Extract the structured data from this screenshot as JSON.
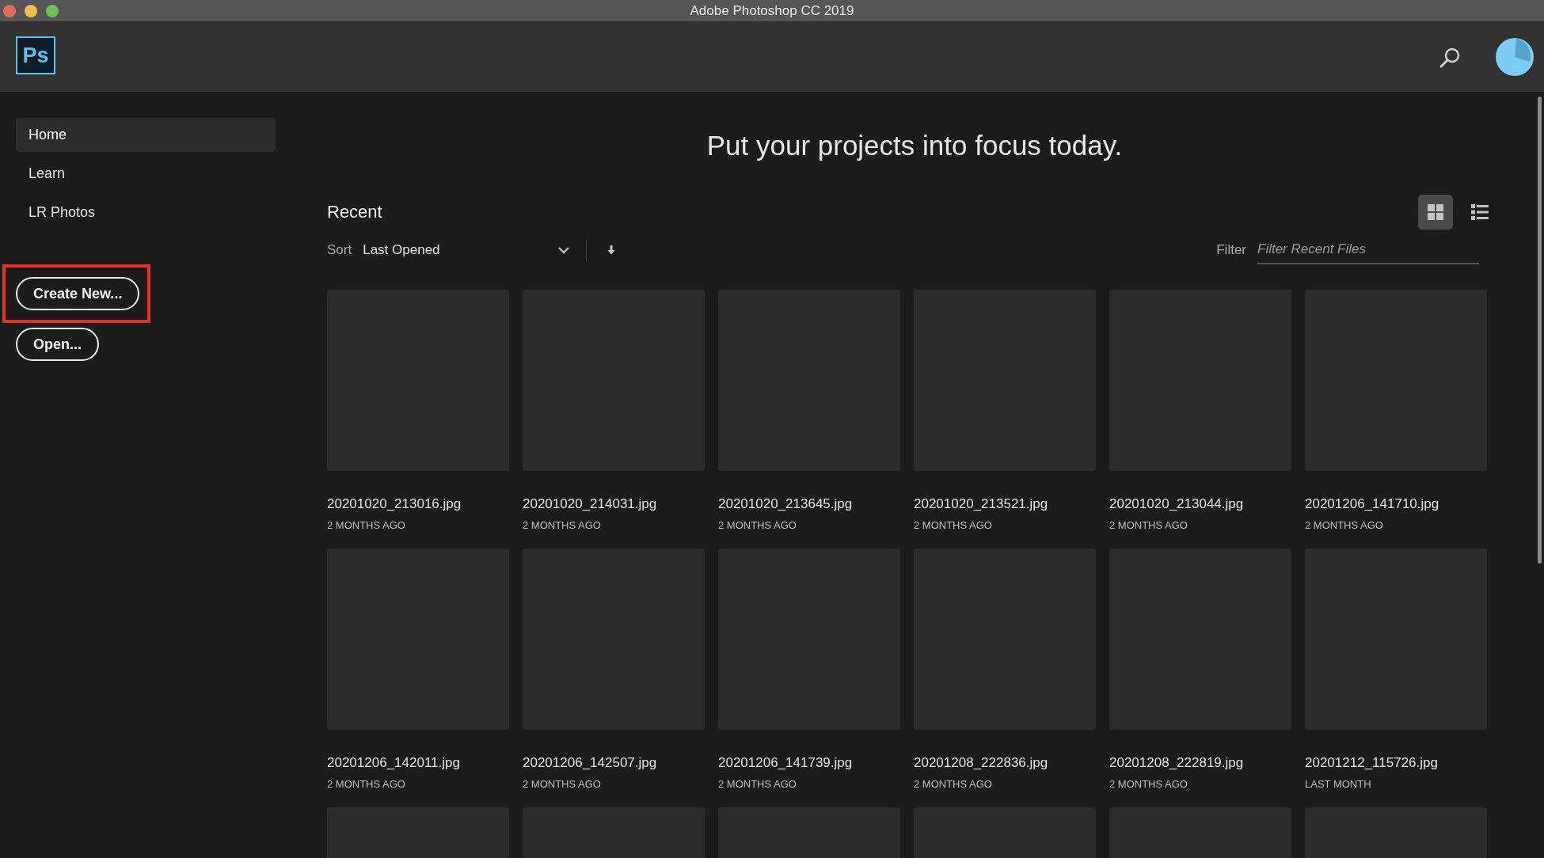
{
  "window": {
    "title": "Adobe Photoshop CC 2019"
  },
  "header": {
    "logo": "Ps"
  },
  "sidebar": {
    "items": [
      {
        "label": "Home",
        "selected": true
      },
      {
        "label": "Learn",
        "selected": false
      },
      {
        "label": "LR Photos",
        "selected": false
      }
    ],
    "buttons": [
      {
        "label": "Create New...",
        "highlighted": true
      },
      {
        "label": "Open...",
        "highlighted": false
      }
    ]
  },
  "main": {
    "headline": "Put your projects into focus today.",
    "section_title": "Recent",
    "sort": {
      "label": "Sort",
      "value": "Last Opened"
    },
    "views": [
      {
        "kind": "grid",
        "selected": true
      },
      {
        "kind": "list",
        "selected": false
      }
    ],
    "filter": {
      "label": "Filter",
      "placeholder": "Filter Recent Files"
    },
    "files": [
      {
        "name": "20201020_213016.jpg",
        "age": "2 MONTHS AGO"
      },
      {
        "name": "20201020_214031.jpg",
        "age": "2 MONTHS AGO"
      },
      {
        "name": "20201020_213645.jpg",
        "age": "2 MONTHS AGO"
      },
      {
        "name": "20201020_213521.jpg",
        "age": "2 MONTHS AGO"
      },
      {
        "name": "20201020_213044.jpg",
        "age": "2 MONTHS AGO"
      },
      {
        "name": "20201206_141710.jpg",
        "age": "2 MONTHS AGO"
      },
      {
        "name": "20201206_142011.jpg",
        "age": "2 MONTHS AGO"
      },
      {
        "name": "20201206_142507.jpg",
        "age": "2 MONTHS AGO"
      },
      {
        "name": "20201206_141739.jpg",
        "age": "2 MONTHS AGO"
      },
      {
        "name": "20201208_222836.jpg",
        "age": "2 MONTHS AGO"
      },
      {
        "name": "20201208_222819.jpg",
        "age": "2 MONTHS AGO"
      },
      {
        "name": "20201212_115726.jpg",
        "age": "LAST MONTH"
      }
    ]
  }
}
